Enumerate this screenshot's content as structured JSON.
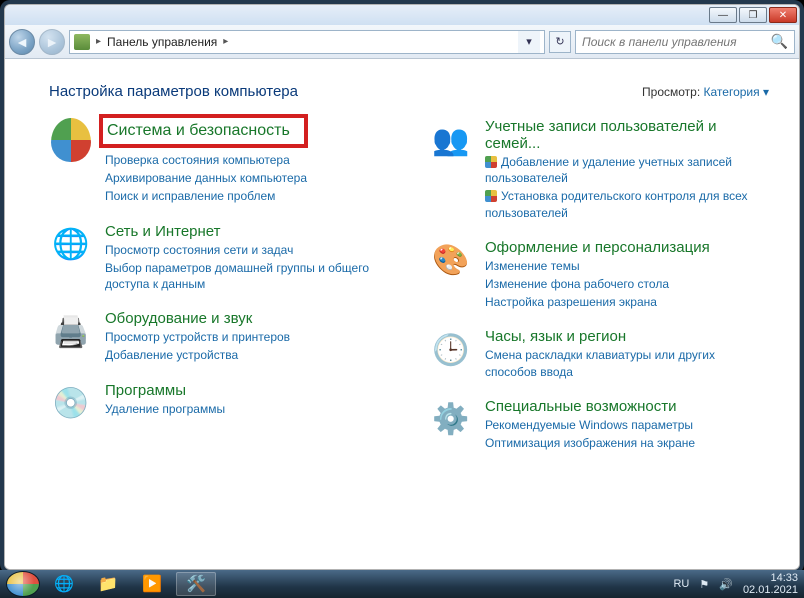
{
  "nav": {
    "breadcrumb_root": "Панель управления",
    "search_placeholder": "Поиск в панели управления"
  },
  "header": {
    "title": "Настройка параметров компьютера",
    "view_label": "Просмотр:",
    "view_value": "Категория"
  },
  "left": [
    {
      "title": "Система и безопасность",
      "highlight": true,
      "links": [
        {
          "text": "Проверка состояния компьютера"
        },
        {
          "text": "Архивирование данных компьютера"
        },
        {
          "text": "Поиск и исправление проблем"
        }
      ]
    },
    {
      "title": "Сеть и Интернет",
      "links": [
        {
          "text": "Просмотр состояния сети и задач"
        },
        {
          "text": "Выбор параметров домашней группы и общего доступа к данным"
        }
      ]
    },
    {
      "title": "Оборудование и звук",
      "links": [
        {
          "text": "Просмотр устройств и принтеров"
        },
        {
          "text": "Добавление устройства"
        }
      ]
    },
    {
      "title": "Программы",
      "links": [
        {
          "text": "Удаление программы"
        }
      ]
    }
  ],
  "right": [
    {
      "title": "Учетные записи пользователей и семей...",
      "links": [
        {
          "text": "Добавление и удаление учетных записей пользователей",
          "shield": true
        },
        {
          "text": "Установка родительского контроля для всех пользователей",
          "shield": true
        }
      ]
    },
    {
      "title": "Оформление и персонализация",
      "links": [
        {
          "text": "Изменение темы"
        },
        {
          "text": "Изменение фона рабочего стола"
        },
        {
          "text": "Настройка разрешения экрана"
        }
      ]
    },
    {
      "title": "Часы, язык и регион",
      "links": [
        {
          "text": "Смена раскладки клавиатуры или других способов ввода"
        }
      ]
    },
    {
      "title": "Специальные возможности",
      "links": [
        {
          "text": "Рекомендуемые Windows параметры"
        },
        {
          "text": "Оптимизация изображения на экране"
        }
      ]
    }
  ],
  "taskbar": {
    "lang": "RU",
    "time": "14:33",
    "date": "02.01.2021"
  }
}
